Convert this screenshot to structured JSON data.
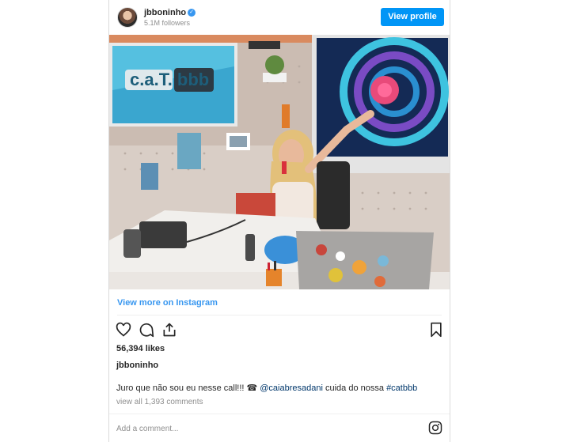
{
  "header": {
    "username": "jbboninho",
    "followers": "5.1M followers",
    "view_profile_label": "View profile"
  },
  "photo": {
    "screen_text": "c.a.T. bbb"
  },
  "view_more_label": "View more on Instagram",
  "actions": {
    "icons": [
      "heart-icon",
      "comment-icon",
      "share-icon",
      "bookmark-icon"
    ]
  },
  "likes": "56,394 likes",
  "caption": {
    "username": "jbboninho",
    "text_start": "Juro que não sou eu nesse call!!! ☎ ",
    "mention": "@caiabresadani",
    "text_mid": " cuida do nossa ",
    "hashtag": "#catbbb"
  },
  "comments_label": "view all 1,393 comments",
  "add_comment_placeholder": "Add a comment...",
  "colors": {
    "accent": "#0095f6",
    "link": "#3897f0",
    "muted": "#8e8e8e"
  }
}
